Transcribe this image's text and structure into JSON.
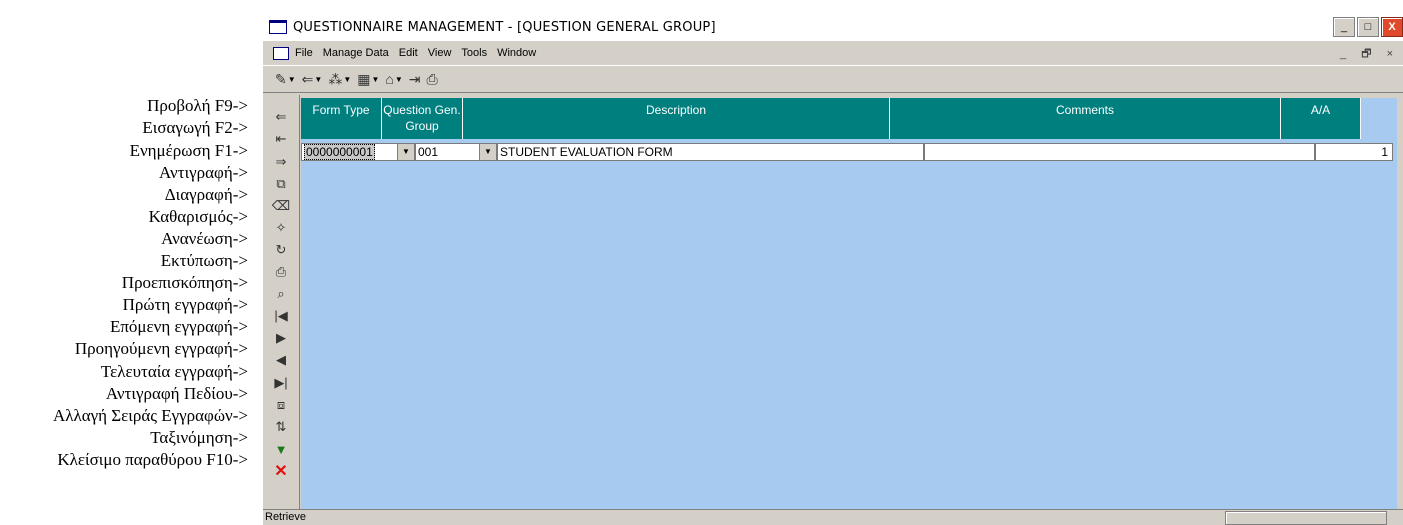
{
  "annotations": [
    "Προβολή F9->",
    "Εισαγωγή F2->",
    "Ενημέρωση F1->",
    "Αντιγραφή->",
    "Διαγραφή->",
    "Καθαρισμός->",
    "Ανανέωση->",
    "Εκτύπωση->",
    "Προεπισκόπηση->",
    "Πρώτη εγγραφή->",
    "Επόμενη εγγραφή->",
    "Προηγούμενη εγγραφή->",
    "Τελευταία εγγραφή->",
    "Αντιγραφή Πεδίου->",
    "Αλλαγή Σειράς Εγγραφών->",
    "Ταξινόμηση->",
    "Κλείσιμο παραθύρου F10->"
  ],
  "window": {
    "title": "QUESTIONNAIRE MANAGEMENT - [QUESTION GENERAL GROUP]",
    "buttons": {
      "minimize": "_",
      "maximize": "□",
      "close": "X"
    }
  },
  "menu": {
    "items": [
      "File",
      "Manage Data",
      "Edit",
      "View",
      "Tools",
      "Window"
    ],
    "mdi_controls": "_ 🗗 ×"
  },
  "toolbar": {
    "buttons": [
      {
        "icon": "edit-icon",
        "glyph": "✎"
      },
      {
        "icon": "insert-icon",
        "glyph": "⇐"
      },
      {
        "icon": "dots-icon",
        "glyph": "⁂"
      },
      {
        "icon": "grid-icon",
        "glyph": "▦"
      },
      {
        "icon": "bank-icon",
        "glyph": "⌂"
      },
      {
        "icon": "exit-icon",
        "glyph": "⇥"
      },
      {
        "icon": "print-icon",
        "glyph": "⎙"
      }
    ]
  },
  "side_toolbar": [
    {
      "name": "view-icon",
      "glyph": "⇐"
    },
    {
      "name": "insert-icon",
      "glyph": "⇤"
    },
    {
      "name": "update-icon",
      "glyph": "⇒"
    },
    {
      "name": "copy-icon",
      "glyph": "⧉"
    },
    {
      "name": "delete-icon",
      "glyph": "⌫"
    },
    {
      "name": "clear-icon",
      "glyph": "✧"
    },
    {
      "name": "refresh-icon",
      "glyph": "↻"
    },
    {
      "name": "print-icon",
      "glyph": "⎙"
    },
    {
      "name": "preview-icon",
      "glyph": "⌕"
    },
    {
      "name": "first-record-icon",
      "glyph": "|◀"
    },
    {
      "name": "next-record-icon",
      "glyph": "▶"
    },
    {
      "name": "previous-record-icon",
      "glyph": "◀"
    },
    {
      "name": "last-record-icon",
      "glyph": "▶|"
    },
    {
      "name": "copy-field-icon",
      "glyph": "⧈"
    },
    {
      "name": "reorder-records-icon",
      "glyph": "⇅"
    },
    {
      "name": "sort-icon",
      "glyph": "▼"
    },
    {
      "name": "close-window-icon",
      "glyph": "✕"
    }
  ],
  "grid": {
    "columns": [
      {
        "label": "Form Type"
      },
      {
        "label": "Question Gen. Group"
      },
      {
        "label": "Description"
      },
      {
        "label": "Comments"
      },
      {
        "label": "A/A"
      }
    ],
    "rows": [
      {
        "form_type": "0000000001",
        "question_gen_group": "001",
        "description": "STUDENT EVALUATION FORM",
        "comments": "",
        "aa": "1"
      }
    ]
  },
  "status": {
    "text": "Retrieve"
  },
  "colors": {
    "header_bg": "#007f7f",
    "grid_bg": "#a6caf0",
    "window_bg": "#d4d0c8",
    "close_btn": "#e04a2a"
  }
}
